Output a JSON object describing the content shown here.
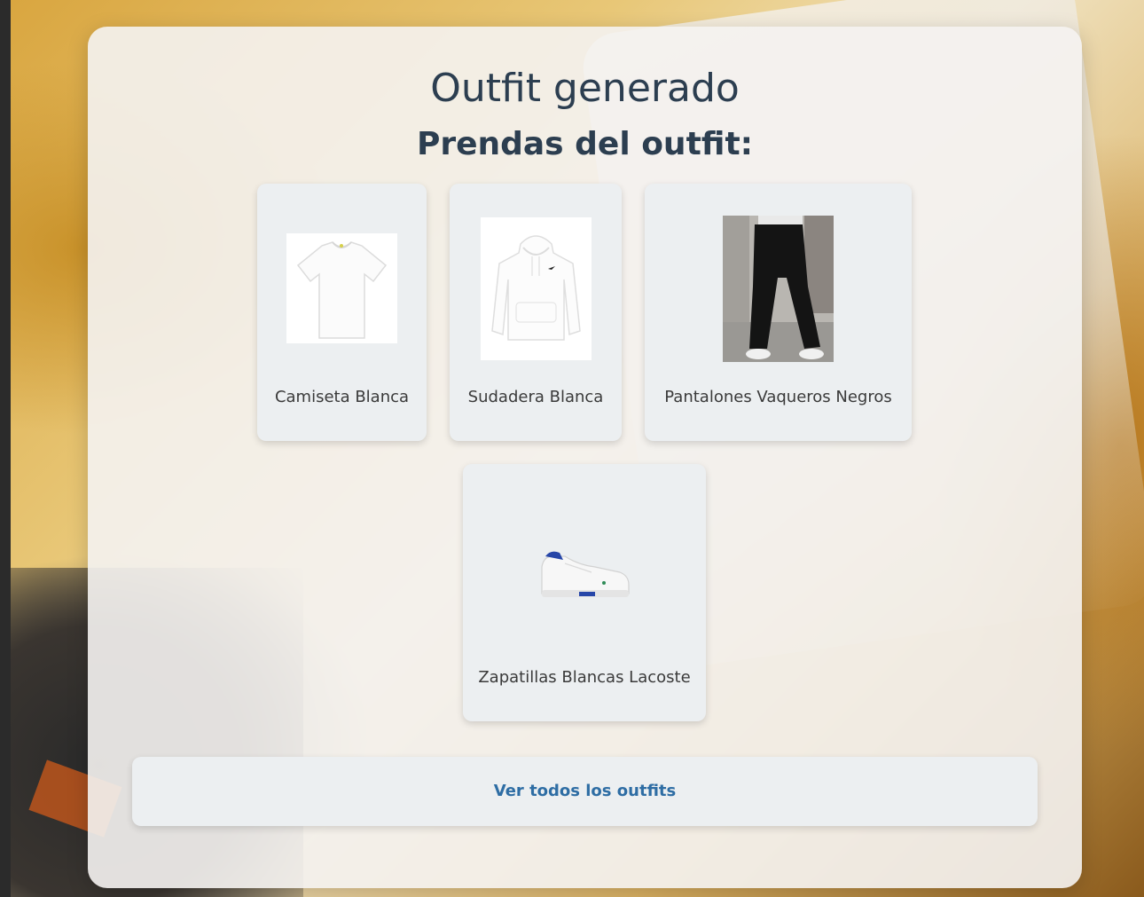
{
  "page": {
    "title": "Outfit generado",
    "subtitle": "Prendas del outfit:"
  },
  "items": [
    {
      "label": "Camiseta Blanca",
      "icon": "tshirt-icon"
    },
    {
      "label": "Sudadera Blanca",
      "icon": "hoodie-icon"
    },
    {
      "label": "Pantalones Vaqueros Negros",
      "icon": "pants-icon"
    },
    {
      "label": "Zapatillas Blancas Lacoste",
      "icon": "sneaker-icon"
    }
  ],
  "actions": {
    "view_all_label": "Ver todos los outfits"
  },
  "colors": {
    "heading": "#2c3e50",
    "link": "#2e6da4",
    "card_bg": "#eceff1"
  }
}
